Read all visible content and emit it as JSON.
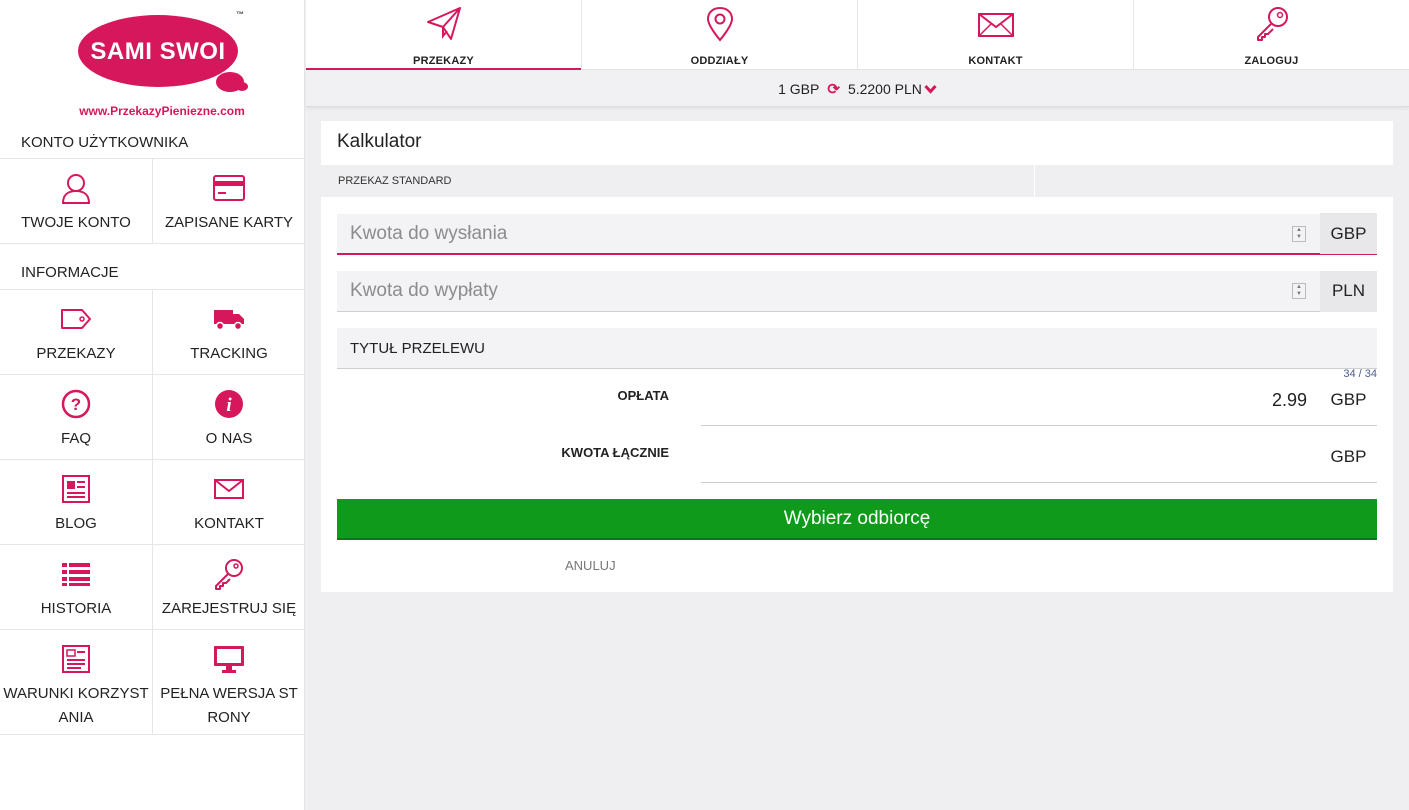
{
  "brand": {
    "name": "SAMI SWOI",
    "tm": "™",
    "url": "www.PrzekazyPieniezne.com"
  },
  "sidebar": {
    "section_account": "KONTO UŻYTKOWNIKA",
    "account_items": [
      {
        "label": "TWOJE KONTO",
        "icon": "user-icon"
      },
      {
        "label": "ZAPISANE KARTY",
        "icon": "credit-card-icon"
      }
    ],
    "section_info": "INFORMACJE",
    "info_items": [
      {
        "label": "PRZEKAZY",
        "icon": "tag-icon"
      },
      {
        "label": "TRACKING",
        "icon": "truck-icon"
      },
      {
        "label": "FAQ",
        "icon": "question-circle-icon"
      },
      {
        "label": "O NAS",
        "icon": "info-circle-icon"
      },
      {
        "label": "BLOG",
        "icon": "newspaper-icon"
      },
      {
        "label": "KONTAKT",
        "icon": "envelope-icon"
      },
      {
        "label": "HISTORIA",
        "icon": "list-icon"
      },
      {
        "label": "ZAREJESTRUJ SIĘ",
        "icon": "key-icon"
      },
      {
        "label": "WARUNKI KORZYST\nANIA",
        "icon": "document-icon"
      },
      {
        "label": "PEŁNA WERSJA ST\nRONY",
        "icon": "monitor-icon"
      }
    ]
  },
  "topnav": {
    "items": [
      {
        "label": "PRZEKAZY",
        "icon": "paper-plane-icon",
        "active": true
      },
      {
        "label": "ODDZIAŁY",
        "icon": "map-pin-icon",
        "active": false
      },
      {
        "label": "KONTAKT",
        "icon": "envelope-icon",
        "active": false
      },
      {
        "label": "ZALOGUJ",
        "icon": "key-icon",
        "active": false
      }
    ]
  },
  "rate": {
    "from": "1 GBP",
    "to": "5.2200 PLN",
    "refresh_glyph": "⟳"
  },
  "calculator": {
    "title": "Kalkulator",
    "tab_standard": "PRZEKAZ STANDARD",
    "send_placeholder": "Kwota do wysłania",
    "send_currency": "GBP",
    "receive_placeholder": "Kwota do wypłaty",
    "receive_currency": "PLN",
    "title_field": "TYTUŁ PRZELEWU",
    "counter": "34 / 34",
    "fee_label": "OPŁATA",
    "fee_value": "2.99",
    "fee_currency": "GBP",
    "total_label": "KWOTA ŁĄCZNIE",
    "total_value": "",
    "total_currency": "GBP",
    "submit_label": "Wybierz odbiorcę",
    "cancel_label": "ANULUJ"
  },
  "colors": {
    "accent": "#d6175b",
    "button": "#0f9a1b"
  }
}
